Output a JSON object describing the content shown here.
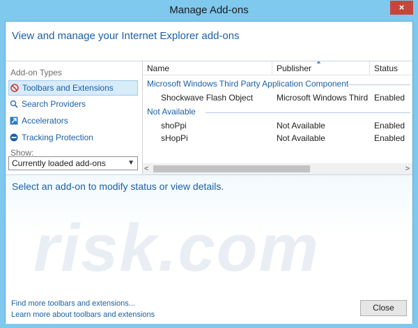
{
  "window": {
    "title": "Manage Add-ons",
    "close_glyph": "×"
  },
  "header": {
    "text": "View and manage your Internet Explorer add-ons"
  },
  "left_panel": {
    "section_label": "Add-on Types",
    "types": [
      {
        "label": "Toolbars and Extensions",
        "icon": "toolbars-icon"
      },
      {
        "label": "Search Providers",
        "icon": "search-icon"
      },
      {
        "label": "Accelerators",
        "icon": "accelerators-icon"
      },
      {
        "label": "Tracking Protection",
        "icon": "tracking-protection-icon"
      }
    ],
    "show_label": "Show:",
    "show_select": {
      "value": "Currently loaded add-ons"
    }
  },
  "grid": {
    "columns": [
      "Name",
      "Publisher",
      "Status"
    ],
    "groups": [
      {
        "name": "Microsoft Windows Third Party Application Component",
        "rows": [
          {
            "name": "Shockwave Flash Object",
            "publisher": "Microsoft Windows Third...",
            "status": "Enabled"
          }
        ]
      },
      {
        "name": "Not Available",
        "rows": [
          {
            "name": "shoPpi",
            "publisher": "Not Available",
            "status": "Enabled"
          },
          {
            "name": "sHopPi",
            "publisher": "Not Available",
            "status": "Enabled"
          }
        ]
      }
    ]
  },
  "details": {
    "prompt": "Select an add-on to modify status or view details.",
    "watermark": "risk.com",
    "links": [
      "Find more toolbars and extensions...",
      "Learn more about toolbars and extensions"
    ],
    "close_label": "Close"
  },
  "colors": {
    "accent": "#1a5fa5",
    "frame": "#7fc8ee",
    "selection": "#d7ebf9",
    "close": "#c7463c"
  }
}
